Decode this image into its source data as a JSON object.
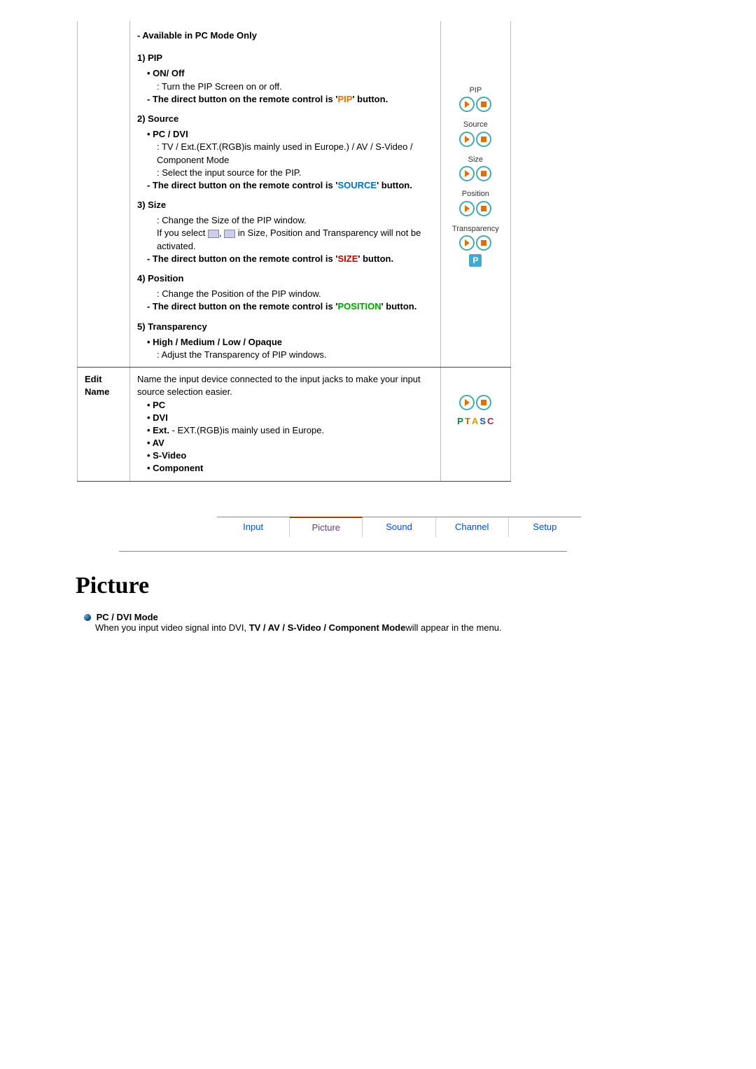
{
  "row1": {
    "avail": "- Available in PC Mode Only",
    "pip_h": "1) PIP",
    "onoff": "• ON/ Off",
    "onoff_desc": ": Turn the PIP Screen on or off.",
    "pip_direct_pre": "- The direct button on the remote control is '",
    "pip_direct_word": "PIP",
    "pip_direct_post": "' button.",
    "source_h": "2) Source",
    "pcdvi": "• PC / DVI",
    "src_line1": ": TV / Ext.(EXT.(RGB)is mainly used in Europe.) / AV / S-Video / Component Mode",
    "src_line2": ": Select the input source for the PIP.",
    "src_direct_pre": "- The direct button on the remote control is '",
    "src_direct_word": "SOURCE",
    "src_direct_post": "' button.",
    "size_h": "3) Size",
    "size_l1": ": Change the Size of the PIP window.",
    "size_l2a": "If you select ",
    "size_l2b": " in Size, Position and Transparency will not be activated.",
    "size_direct_pre": "- The direct button on the remote control is '",
    "size_direct_word": "SIZE",
    "size_direct_post": "' button.",
    "pos_h": "4) Position",
    "pos_l1": ": Change the Position of the PIP window.",
    "pos_direct_pre": "- The direct button on the remote control is '",
    "pos_direct_word": "POSITION",
    "pos_direct_post": "' button.",
    "trans_h": "5) Transparency",
    "trans_opt": "• High / Medium / Low / Opaque",
    "trans_desc": ": Adjust the Transparency of PIP windows.",
    "icon_labels": {
      "pip": "PIP",
      "source": "Source",
      "size": "Size",
      "position": "Position",
      "transparency": "Transparency"
    }
  },
  "row2": {
    "label": "Edit Name",
    "intro": "Name the input device connected to the input jacks to make your input source selection easier.",
    "b1": "• PC",
    "b2": "• DVI",
    "b3a": "• Ext.",
    "b3b": " - EXT.(RGB)is mainly used in Europe.",
    "b4": "• AV",
    "b5": "• S-Video",
    "b6": "• Component",
    "ptasc": {
      "p": "P",
      "t": "T",
      "a": "A",
      "s": "S",
      "c": "C"
    }
  },
  "tabs": {
    "t1": "Input",
    "t2": "Picture",
    "t3": "Sound",
    "t4": "Channel",
    "t5": "Setup"
  },
  "section": {
    "title": "Picture",
    "mode_t": "PC / DVI Mode",
    "mode_desc_a": "When you input video signal into DVI, ",
    "mode_desc_b": "TV / AV / S-Video / Component Mode",
    "mode_desc_c": "will appear in the menu."
  }
}
